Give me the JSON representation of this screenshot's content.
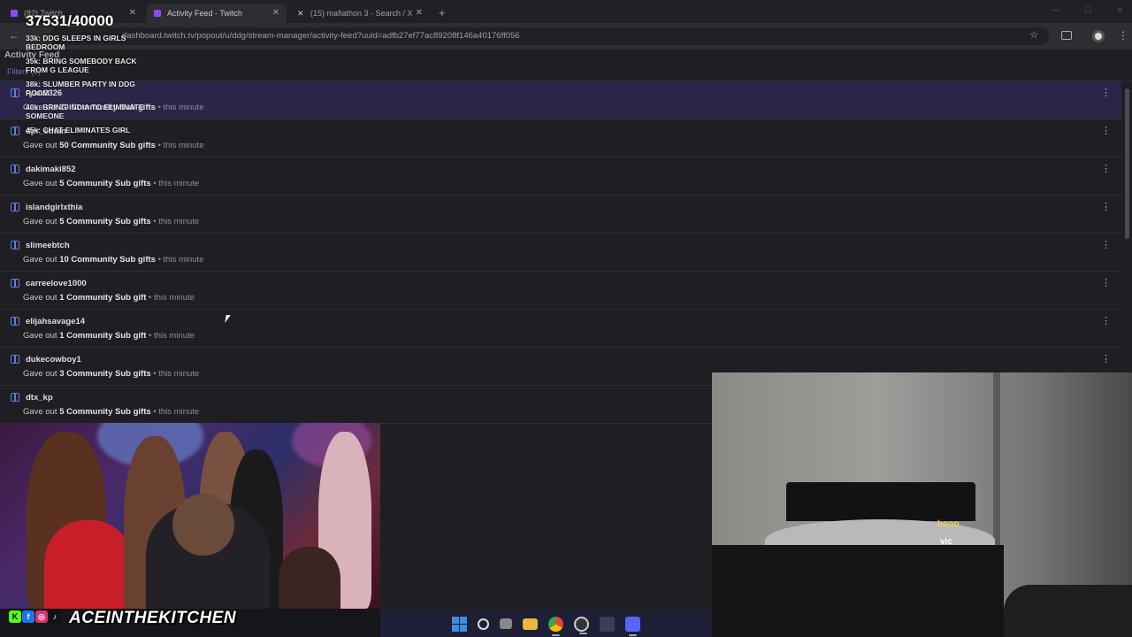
{
  "browser": {
    "tabs": [
      {
        "title": "(82) Twitch",
        "active": false,
        "favicon_color": "#9146ff"
      },
      {
        "title": "Activity Feed - Twitch",
        "active": true,
        "favicon_color": "#9146ff"
      },
      {
        "title": "(15) mafiathon 3 - Search / X",
        "active": false,
        "favicon_color": "#e7e9ea"
      }
    ],
    "new_tab_icon": "plus-icon",
    "url": "dashboard.twitch.tv/popout/u/ddg/stream-manager/activity-feed?uuid=adfb27ef77ac89208f146a40176ff056"
  },
  "panel": {
    "title": "Activity Feed",
    "filters_label": "Filters (1)"
  },
  "overlay": {
    "goal": "37531/40000",
    "milestones": [
      "33k: DDG SLEEPS IN GIRLS BEDROOM",
      "35k: BRING SOMEBODY BACK FROM G LEAGUE",
      "38k: SLUMBER PARTY IN DDG ROOM",
      "40k: BRING INDIA TO ELIMINATE SOMEONE",
      "45k: CHAT ELIMINATES GIRL"
    ]
  },
  "feed": [
    {
      "user": "ryan2326",
      "pre": "Gave out ",
      "amount": "20 Community Sub gifts",
      "time": " • this minute",
      "highlighted": true
    },
    {
      "user": "dpr_ethan",
      "pre": "Gave out ",
      "amount": "50 Community Sub gifts",
      "time": " • this minute",
      "highlighted": false
    },
    {
      "user": "dakimaki852",
      "pre": "Gave out ",
      "amount": "5 Community Sub gifts",
      "time": " • this minute",
      "highlighted": false
    },
    {
      "user": "islandgirlxthia",
      "pre": "Gave out ",
      "amount": "5 Community Sub gifts",
      "time": " • this minute",
      "highlighted": false
    },
    {
      "user": "slimeebtch",
      "pre": "Gave out ",
      "amount": "10 Community Sub gifts",
      "time": " • this minute",
      "highlighted": false
    },
    {
      "user": "carreelove1000",
      "pre": "Gave out ",
      "amount": "1 Community Sub gift",
      "time": " • this minute",
      "highlighted": false
    },
    {
      "user": "elijahsavage14",
      "pre": "Gave out ",
      "amount": "1 Community Sub gift",
      "time": " • this minute",
      "highlighted": false
    },
    {
      "user": "dukecowboy1",
      "pre": "Gave out ",
      "amount": "3 Community Sub gifts",
      "time": " • this minute",
      "highlighted": false
    },
    {
      "user": "dtx_kp",
      "pre": "Gave out ",
      "amount": "5 Community Sub gifts",
      "time": " • this minute",
      "highlighted": false
    }
  ],
  "webcam": {
    "chat_tag_1": "booo",
    "chat_tag_2": "vic"
  },
  "branding": {
    "name": "ACEINTHEKITCHEN",
    "social_icons": [
      "kick-icon",
      "facebook-icon",
      "instagram-icon",
      "tiktok-icon"
    ]
  },
  "taskbar": {
    "icons": [
      "windows-start-icon",
      "search-icon",
      "task-view-icon",
      "file-explorer-icon",
      "chrome-icon",
      "obs-icon",
      "media-icon",
      "discord-icon"
    ]
  }
}
